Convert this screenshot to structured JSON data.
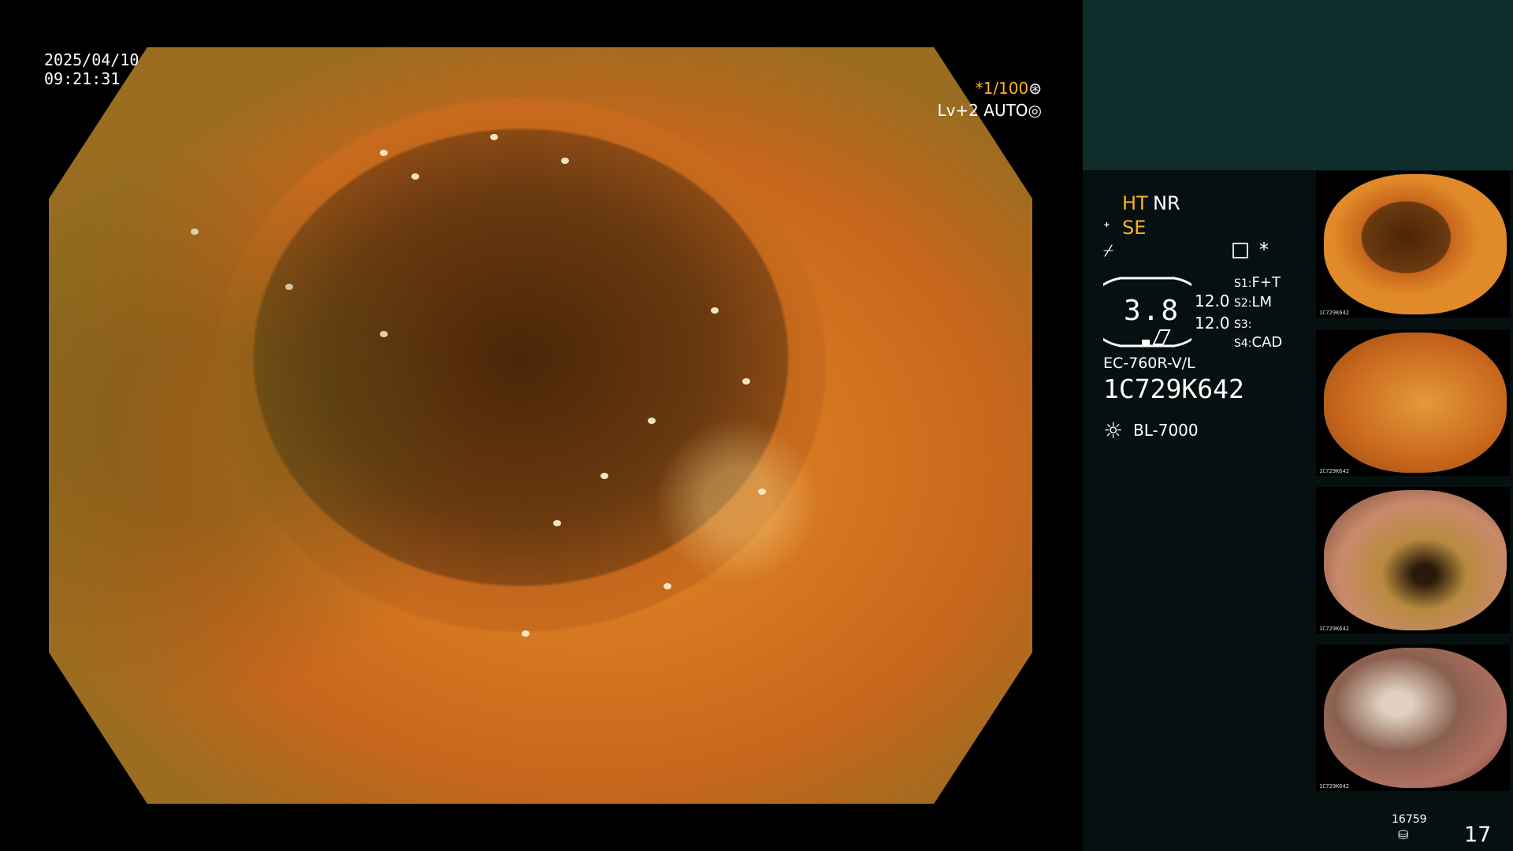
{
  "view": {
    "date": "2025/04/10",
    "time": "09:21:31",
    "shutter": "*1/100",
    "shutter_icon": "⊛",
    "iris": "Lv+2 AUTO",
    "iris_icon": "◎"
  },
  "panel": {
    "mode_ht": "HT",
    "mode_nr": "NR",
    "mode_se": "SE",
    "se_icon": "ᐩ",
    "struct_icon": "⌿",
    "asterisk": "*",
    "gauge_value": "3.8",
    "value_a": "12.0",
    "value_b": "12.0",
    "slots": [
      {
        "key": "S1",
        "value": "F+T"
      },
      {
        "key": "S2",
        "value": "LM"
      },
      {
        "key": "S3",
        "value": ""
      },
      {
        "key": "S4",
        "value": "CAD"
      }
    ],
    "scope_model": "EC-760R-V/L",
    "scope_serial": "1C729K642",
    "light_source": "BL-7000",
    "light_icon": "☼"
  },
  "thumbnails": [
    {
      "caption": "1C729K642"
    },
    {
      "caption": "1C729K642"
    },
    {
      "caption": "1C729K642"
    },
    {
      "caption": "1C729K642"
    }
  ],
  "storage": {
    "count": "16759",
    "image_count": "17"
  }
}
